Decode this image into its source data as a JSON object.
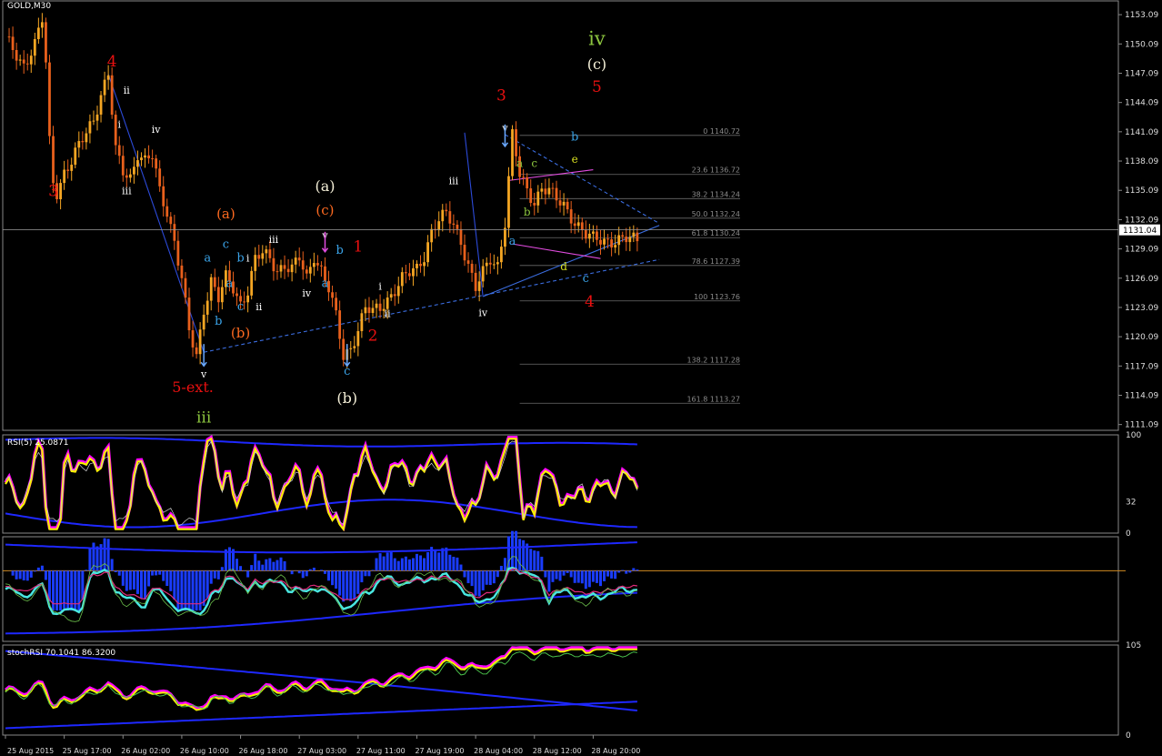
{
  "chart_data": {
    "type": "candlestick",
    "symbol_label": "GOLD,M30",
    "current_price_label": "1131.04",
    "current_price": 1131.04,
    "price_axis": {
      "ylim": [
        1110.5,
        1154.5
      ],
      "ticks": [
        "1153.09",
        "1150.09",
        "1147.09",
        "1144.09",
        "1141.09",
        "1138.09",
        "1135.09",
        "1132.09",
        "1129.09",
        "1126.09",
        "1123.09",
        "1120.09",
        "1117.09",
        "1114.09",
        "1111.09"
      ],
      "tick_values": [
        1153.09,
        1150.09,
        1147.09,
        1144.09,
        1141.09,
        1138.09,
        1135.09,
        1132.09,
        1129.09,
        1126.09,
        1123.09,
        1120.09,
        1117.09,
        1114.09,
        1111.09
      ]
    },
    "time_axis": {
      "ticks": [
        "25 Aug 2015",
        "25 Aug 17:00",
        "26 Aug 02:00",
        "26 Aug 10:00",
        "26 Aug 18:00",
        "27 Aug 03:00",
        "27 Aug 11:00",
        "27 Aug 19:00",
        "28 Aug 04:00",
        "28 Aug 12:00",
        "28 Aug 20:00"
      ],
      "bar_index": [
        0,
        16,
        32,
        48,
        64,
        80,
        96,
        112,
        128,
        144,
        160
      ]
    },
    "price_path": {
      "bars": [
        0,
        5,
        8,
        10,
        11,
        12,
        13,
        14,
        16,
        18,
        20,
        22,
        24,
        26,
        28,
        30,
        32,
        34,
        36,
        38,
        40,
        42,
        44,
        46,
        48,
        50,
        52,
        54,
        56,
        58,
        60,
        62,
        64,
        66,
        68,
        70,
        72,
        74,
        76,
        78,
        80,
        82,
        84,
        86,
        88,
        90,
        92,
        94,
        96,
        98,
        100,
        102,
        104,
        106,
        108,
        110,
        112,
        114,
        116,
        118,
        120,
        122,
        124,
        126,
        128,
        130,
        132,
        134,
        136,
        138,
        140,
        142,
        144,
        146,
        148,
        150,
        152,
        154,
        156,
        158,
        160,
        162,
        164,
        166,
        168,
        170,
        172
      ],
      "close": [
        1150.5,
        1148,
        1150,
        1152.5,
        1148,
        1140,
        1136,
        1135,
        1137,
        1138,
        1139.5,
        1141,
        1142.5,
        1145,
        1147,
        1139,
        1137,
        1136.5,
        1139,
        1138,
        1138.5,
        1135,
        1133,
        1130,
        1126,
        1120.5,
        1118,
        1123,
        1126,
        1124,
        1126,
        1125,
        1123.5,
        1125,
        1128,
        1128.5,
        1128,
        1127,
        1127.5,
        1127,
        1128,
        1126,
        1128.5,
        1127,
        1125,
        1122,
        1118,
        1119,
        1121,
        1123,
        1122.5,
        1123,
        1124,
        1125,
        1126,
        1126.5,
        1127,
        1128.5,
        1131,
        1132,
        1132.5,
        1131.5,
        1130,
        1127.5,
        1125,
        1126.5,
        1128,
        1127.5,
        1132,
        1140.7,
        1136.5,
        1135,
        1134,
        1135.5,
        1135,
        1134,
        1133.5,
        1132.5,
        1131.5,
        1130.5,
        1130,
        1130,
        1130,
        1130,
        1130,
        1130,
        1130
      ]
    },
    "fibonacci_levels": [
      {
        "ratio": "0",
        "price": 1140.72,
        "label": "0 1140.72"
      },
      {
        "ratio": "23.6",
        "price": 1136.72,
        "label": "23.6 1136.72"
      },
      {
        "ratio": "38.2",
        "price": 1134.24,
        "label": "38.2 1134.24"
      },
      {
        "ratio": "50.0",
        "price": 1132.24,
        "label": "50.0 1132.24"
      },
      {
        "ratio": "61.8",
        "price": 1130.24,
        "label": "61.8 1130.24"
      },
      {
        "ratio": "78.6",
        "price": 1127.39,
        "label": "78.6 1127.39"
      },
      {
        "ratio": "100",
        "price": 1123.76,
        "label": "100 1123.76"
      },
      {
        "ratio": "138.2",
        "price": 1117.28,
        "label": "138.2 1117.28"
      },
      {
        "ratio": "161.8",
        "price": 1113.27,
        "label": "161.8 1113.27"
      }
    ],
    "wave_labels": [
      {
        "text": "3",
        "color": "#e81010",
        "bar": 13,
        "price": 1134.5,
        "size": 17
      },
      {
        "text": "4",
        "color": "#e81010",
        "bar": 29,
        "price": 1147.8,
        "size": 17
      },
      {
        "text": "ii",
        "color": "#ffffff",
        "bar": 33,
        "price": 1145,
        "size": 11
      },
      {
        "text": "i",
        "color": "#ffffff",
        "bar": 31,
        "price": 1141.5,
        "size": 11
      },
      {
        "text": "iv",
        "color": "#ffffff",
        "bar": 41,
        "price": 1141,
        "size": 11
      },
      {
        "text": "iii",
        "color": "#ffffff",
        "bar": 33,
        "price": 1134.7,
        "size": 11
      },
      {
        "text": "a",
        "color": "#3aa3e8",
        "bar": 55,
        "price": 1127.8,
        "size": 13
      },
      {
        "text": "c",
        "color": "#3aa3e8",
        "bar": 60,
        "price": 1129.2,
        "size": 13
      },
      {
        "text": "b",
        "color": "#3aa3e8",
        "bar": 64,
        "price": 1127.8,
        "size": 13
      },
      {
        "text": "i",
        "color": "#ffffff",
        "bar": 66,
        "price": 1127.8,
        "size": 11
      },
      {
        "text": "a",
        "color": "#3aa3e8",
        "bar": 61,
        "price": 1125.2,
        "size": 13
      },
      {
        "text": "c",
        "color": "#3aa3e8",
        "bar": 64,
        "price": 1122.8,
        "size": 13
      },
      {
        "text": "ii",
        "color": "#ffffff",
        "bar": 69,
        "price": 1122.8,
        "size": 11
      },
      {
        "text": "b",
        "color": "#3aa3e8",
        "bar": 58,
        "price": 1121.3,
        "size": 13
      },
      {
        "text": "iii",
        "color": "#ffffff",
        "bar": 73,
        "price": 1129.7,
        "size": 11
      },
      {
        "text": "iv",
        "color": "#ffffff",
        "bar": 82,
        "price": 1124.2,
        "size": 11
      },
      {
        "text": "(a)",
        "color": "#ff6a20",
        "bar": 60,
        "price": 1132.2,
        "size": 15
      },
      {
        "text": "(b)",
        "color": "#ff6a20",
        "bar": 64,
        "price": 1120,
        "size": 15
      },
      {
        "text": "v",
        "color": "#ffffff",
        "bar": 54,
        "price": 1115.9,
        "size": 11
      },
      {
        "text": "5-ext.",
        "color": "#e81010",
        "bar": 51,
        "price": 1114.4,
        "size": 16
      },
      {
        "text": "iii",
        "color": "#8dc63f",
        "bar": 54,
        "price": 1111.3,
        "size": 17
      },
      {
        "text": "(a)",
        "color": "#f5f0d8",
        "bar": 87,
        "price": 1135,
        "size": 16
      },
      {
        "text": "(c)",
        "color": "#ff6a20",
        "bar": 87,
        "price": 1132.6,
        "size": 15
      },
      {
        "text": "v",
        "color": "#ffffff",
        "bar": 87,
        "price": 1130.1,
        "size": 11
      },
      {
        "text": "b",
        "color": "#3aa3e8",
        "bar": 91,
        "price": 1128.6,
        "size": 13
      },
      {
        "text": "a",
        "color": "#3aa3e8",
        "bar": 87,
        "price": 1125.2,
        "size": 13
      },
      {
        "text": "1",
        "color": "#e81010",
        "bar": 96,
        "price": 1128.8,
        "size": 17
      },
      {
        "text": "i",
        "color": "#ffffff",
        "bar": 102,
        "price": 1124.9,
        "size": 11
      },
      {
        "text": "ii",
        "color": "#ffffff",
        "bar": 104,
        "price": 1122.1,
        "size": 11
      },
      {
        "text": "2",
        "color": "#e81010",
        "bar": 100,
        "price": 1119.7,
        "size": 17
      },
      {
        "text": "c",
        "color": "#3aa3e8",
        "bar": 93,
        "price": 1116.2,
        "size": 13
      },
      {
        "text": "(b)",
        "color": "#f5f0d8",
        "bar": 93,
        "price": 1113.3,
        "size": 16
      },
      {
        "text": "iii",
        "color": "#ffffff",
        "bar": 122,
        "price": 1135.7,
        "size": 11
      },
      {
        "text": "iv",
        "color": "#ffffff",
        "bar": 130,
        "price": 1122.2,
        "size": 11
      },
      {
        "text": "3",
        "color": "#e81010",
        "bar": 135,
        "price": 1144.3,
        "size": 17
      },
      {
        "text": "v",
        "color": "#ffffff",
        "bar": 136,
        "price": 1141.1,
        "size": 11
      },
      {
        "text": "a",
        "color": "#8dc63f",
        "bar": 140,
        "price": 1137.5,
        "size": 12
      },
      {
        "text": "c",
        "color": "#8dc63f",
        "bar": 144,
        "price": 1137.5,
        "size": 12
      },
      {
        "text": "b",
        "color": "#8dc63f",
        "bar": 142,
        "price": 1132.5,
        "size": 12
      },
      {
        "text": "a",
        "color": "#3aa3e8",
        "bar": 138,
        "price": 1129.5,
        "size": 13
      },
      {
        "text": "d",
        "color": "#d8e020",
        "bar": 152,
        "price": 1126.9,
        "size": 12
      },
      {
        "text": "c",
        "color": "#3aa3e8",
        "bar": 158,
        "price": 1125.7,
        "size": 13
      },
      {
        "text": "4",
        "color": "#e81010",
        "bar": 159,
        "price": 1123.2,
        "size": 17
      },
      {
        "text": "b",
        "color": "#3aa3e8",
        "bar": 155,
        "price": 1140.2,
        "size": 13
      },
      {
        "text": "e",
        "color": "#d8e020",
        "bar": 155,
        "price": 1137.9,
        "size": 12
      },
      {
        "text": "iv",
        "color": "#8dc63f",
        "bar": 161,
        "price": 1150,
        "size": 21
      },
      {
        "text": "(c)",
        "color": "#f5f0d8",
        "bar": 161,
        "price": 1147.5,
        "size": 16
      },
      {
        "text": "5",
        "color": "#e81010",
        "bar": 161,
        "price": 1145.2,
        "size": 17
      }
    ],
    "trendlines": [
      {
        "from": [
          54,
          1118.5
        ],
        "to": [
          93,
          1121.5
        ],
        "color": "#3b6de0",
        "dash": true
      },
      {
        "from": [
          93,
          1121.5
        ],
        "to": [
          178,
          1128
        ],
        "color": "#3b6de0",
        "dash": true
      },
      {
        "from": [
          130,
          1124.2
        ],
        "to": [
          178,
          1131.5
        ],
        "color": "#3b6de0",
        "dash": false
      },
      {
        "from": [
          136,
          1140.8
        ],
        "to": [
          178,
          1131.7
        ],
        "color": "#3b6de0",
        "dash": true
      },
      {
        "from": [
          137,
          1136.1
        ],
        "to": [
          160,
          1137.2
        ],
        "color": "#e24ce0",
        "dash": false
      },
      {
        "from": [
          138,
          1129.6
        ],
        "to": [
          162,
          1128.1
        ],
        "color": "#e24ce0",
        "dash": false
      },
      {
        "from": [
          28,
          1147
        ],
        "to": [
          54,
          1118.5
        ],
        "color": "#2c4ad8",
        "dash": false
      },
      {
        "from": [
          125,
          1141
        ],
        "to": [
          130,
          1124.2
        ],
        "color": "#2c4ad8",
        "dash": false
      }
    ],
    "indicators": [
      {
        "name": "RSI(5)",
        "label": "RSI(5) 25.0871",
        "value": 25.0871,
        "ylim": [
          0,
          100
        ],
        "ticks": [
          "100",
          "32",
          "0"
        ],
        "tick_values": [
          100,
          32,
          0
        ]
      },
      {
        "name": "oscillator",
        "label": "",
        "ylim": [
          -1,
          1
        ],
        "ticks": [],
        "tick_values": []
      },
      {
        "name": "stochRSI",
        "label": "stochRSI 70.1041 86.3200",
        "values": [
          70.1041,
          86.32
        ],
        "ylim": [
          0,
          105
        ],
        "ticks": [
          "105",
          "0"
        ],
        "tick_values": [
          105,
          0
        ]
      }
    ],
    "title": "",
    "xlabel": "",
    "ylabel": ""
  },
  "colors": {
    "bull_candle": "#f5a623",
    "bear_candle": "#e8601c",
    "wick": "#d9d9d9",
    "fib": "#6b6b6b",
    "rsi_main": "#f8f000",
    "rsi_shadow": "#ff00ff",
    "rsi_band": "#1e28ff",
    "osc_hist": "#1a3cff",
    "osc_line": "#49e6e0",
    "stoch_k": "#f8f000",
    "stoch_d": "#ff00ff"
  }
}
